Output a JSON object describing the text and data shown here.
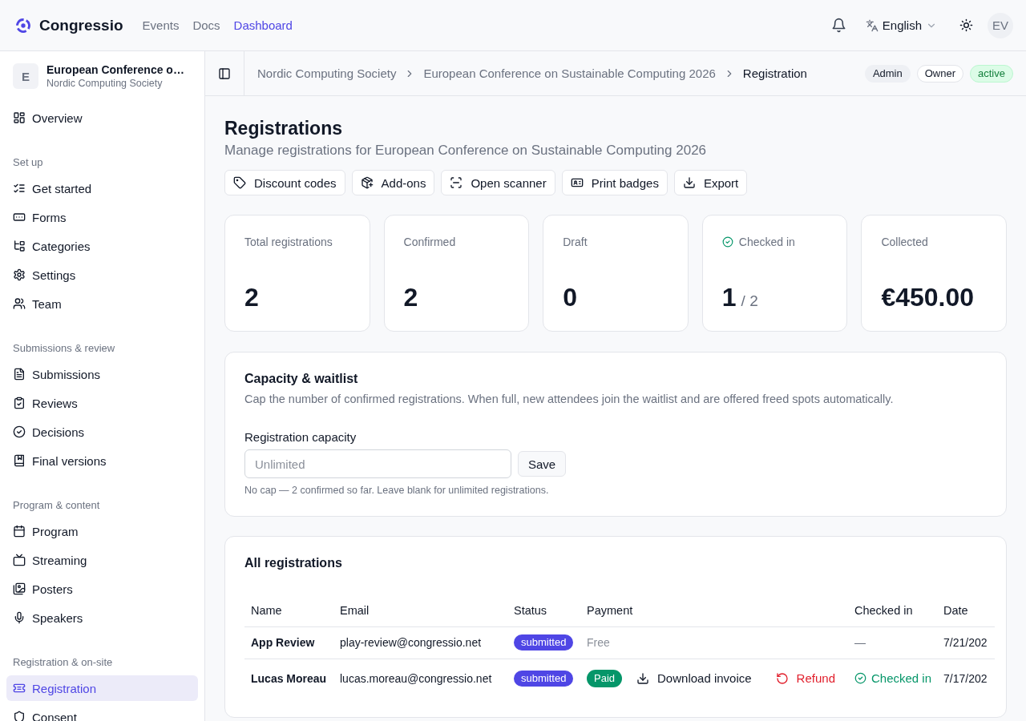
{
  "top_bar": {
    "brand": "Congressio",
    "nav": [
      {
        "label": "Events",
        "selected": false
      },
      {
        "label": "Docs",
        "selected": false
      },
      {
        "label": "Dashboard",
        "selected": true
      }
    ],
    "language": "English",
    "avatar": "EV"
  },
  "sidebar": {
    "event": {
      "initial": "E",
      "title": "European Conference o…",
      "organizer": "Nordic Computing Society"
    },
    "sections": [
      {
        "items": [
          {
            "label": "Overview",
            "selected": false
          }
        ]
      },
      {
        "title": "Set up",
        "items": [
          {
            "label": "Get started",
            "selected": false
          },
          {
            "label": "Forms",
            "selected": false
          },
          {
            "label": "Categories",
            "selected": false
          },
          {
            "label": "Settings",
            "selected": false
          },
          {
            "label": "Team",
            "selected": false
          }
        ]
      },
      {
        "title": "Submissions & review",
        "items": [
          {
            "label": "Submissions",
            "selected": false
          },
          {
            "label": "Reviews",
            "selected": false
          },
          {
            "label": "Decisions",
            "selected": false
          },
          {
            "label": "Final versions",
            "selected": false
          }
        ]
      },
      {
        "title": "Program & content",
        "items": [
          {
            "label": "Program",
            "selected": false
          },
          {
            "label": "Streaming",
            "selected": false
          },
          {
            "label": "Posters",
            "selected": false
          },
          {
            "label": "Speakers",
            "selected": false
          }
        ]
      },
      {
        "title": "Registration & on-site",
        "items": [
          {
            "label": "Registration",
            "selected": true
          },
          {
            "label": "Consent",
            "selected": false
          }
        ]
      }
    ]
  },
  "breadcrumb": {
    "items": [
      {
        "label": "Nordic Computing Society",
        "current": false
      },
      {
        "label": "European Conference on Sustainable Computing 2026",
        "current": false
      },
      {
        "label": "Registration",
        "current": true
      }
    ],
    "badges": [
      {
        "label": "Admin",
        "kind": "role"
      },
      {
        "label": "Owner",
        "kind": "ownership"
      },
      {
        "label": "active",
        "kind": "status"
      }
    ]
  },
  "page": {
    "title": "Registrations",
    "subtitle": "Manage registrations for European Conference on Sustainable Computing 2026",
    "actions": [
      "Discount codes",
      "Add-ons",
      "Open scanner",
      "Print badges",
      "Export"
    ]
  },
  "stats": [
    {
      "label": "Total registrations",
      "value": "2",
      "kind": "plain"
    },
    {
      "label": "Confirmed",
      "value": "2",
      "kind": "plain"
    },
    {
      "label": "Draft",
      "value": "0",
      "kind": "plain"
    },
    {
      "label": "Checked in",
      "value": "1",
      "total": "/ 2",
      "kind": "check"
    },
    {
      "label": "Collected",
      "value": "€450.00",
      "kind": "plain"
    }
  ],
  "capacity": {
    "title": "Capacity & waitlist",
    "description": "Cap the number of confirmed registrations. When full, new attendees join the waitlist and are offered freed spots automatically.",
    "field_label": "Registration capacity",
    "placeholder": "Unlimited",
    "button": "Save",
    "help": "No cap — 2 confirmed so far. Leave blank for unlimited registrations."
  },
  "registrations": {
    "title": "All registrations",
    "columns": [
      "Name",
      "Email",
      "Status",
      "Payment",
      "Checked in",
      "Date"
    ],
    "rows": [
      {
        "name": "App Review",
        "email": "play-review@congressio.net",
        "status": "submitted",
        "payment": {
          "kind": "free",
          "label": "Free"
        },
        "check_in": {
          "checked": false,
          "label": "—"
        },
        "date": "7/21/202"
      },
      {
        "name": "Lucas Moreau",
        "email": "lucas.moreau@congressio.net",
        "status": "submitted",
        "payment": {
          "kind": "paid",
          "label": "Paid",
          "actions": [
            {
              "kind": "download",
              "label": "Download invoice"
            },
            {
              "kind": "refund",
              "label": "Refund"
            }
          ]
        },
        "check_in": {
          "checked": true,
          "label": "Checked in"
        },
        "date": "7/17/202"
      }
    ]
  }
}
